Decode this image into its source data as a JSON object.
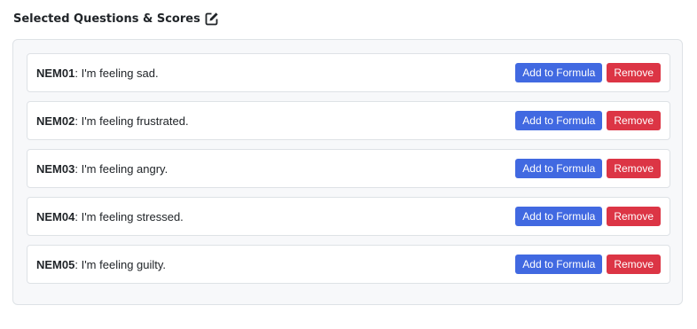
{
  "header": {
    "title": "Selected Questions & Scores",
    "icon": "edit-icon"
  },
  "buttons": {
    "add_label": "Add to Formula",
    "remove_label": "Remove"
  },
  "colors": {
    "add_button": "#4169e1",
    "remove_button": "#dc3545"
  },
  "questions": [
    {
      "code": "NEM01",
      "text": ": I'm feeling sad."
    },
    {
      "code": "NEM02",
      "text": ": I'm feeling frustrated."
    },
    {
      "code": "NEM03",
      "text": ": I'm feeling angry."
    },
    {
      "code": "NEM04",
      "text": ": I'm feeling stressed."
    },
    {
      "code": "NEM05",
      "text": ": I'm feeling guilty."
    }
  ]
}
